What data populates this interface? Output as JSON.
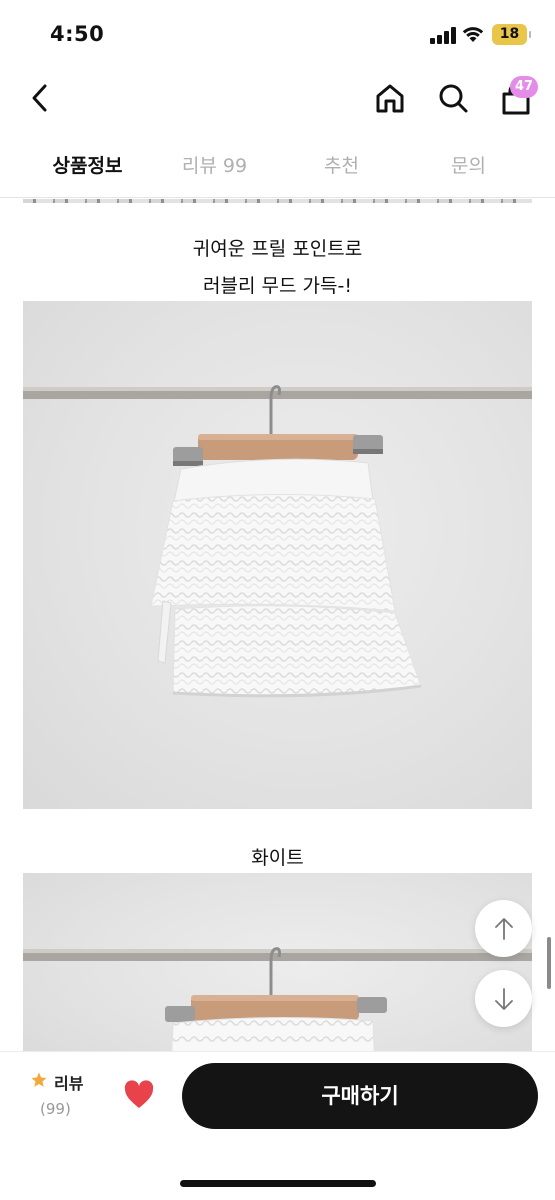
{
  "status_bar": {
    "time": "4:50",
    "battery": "18"
  },
  "nav": {
    "cart_count": "47"
  },
  "tabs": [
    {
      "label": "상품정보",
      "active": true
    },
    {
      "label": "리뷰 99",
      "active": false
    },
    {
      "label": "추천",
      "active": false
    },
    {
      "label": "문의",
      "active": false
    }
  ],
  "content": {
    "caption_1_line1": "귀여운 프릴 포인트로",
    "caption_1_line2": "러블리 무드 가득-!",
    "caption_2": "화이트"
  },
  "bottom_bar": {
    "review_label": "리뷰",
    "review_count": "(99)",
    "buy_label": "구매하기"
  },
  "colors": {
    "accent_badge": "#e58ce8",
    "heart": "#e8434b",
    "star": "#f2a93b",
    "buy_button": "#141414"
  },
  "icons": [
    "back-icon",
    "home-icon",
    "search-icon",
    "cart-icon",
    "arrow-up-icon",
    "arrow-down-icon",
    "star-icon",
    "heart-icon"
  ]
}
